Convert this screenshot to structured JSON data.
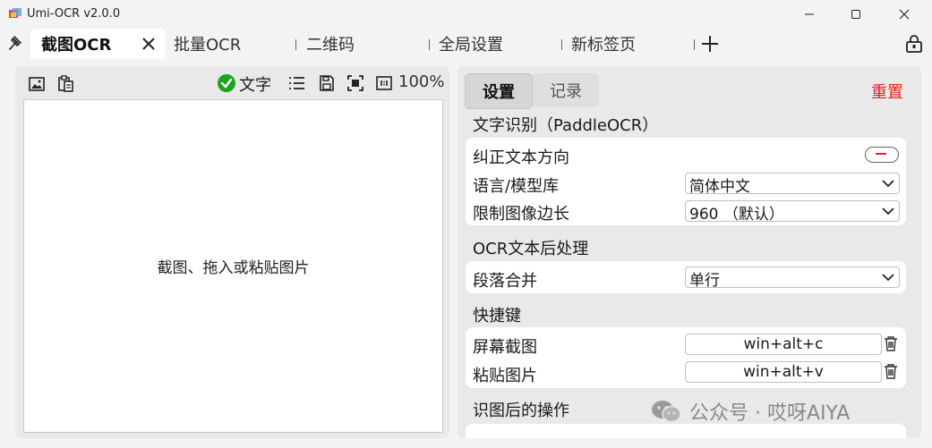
{
  "window": {
    "title": "Umi-OCR v2.0.0"
  },
  "tabs": [
    {
      "label": "截图OCR"
    },
    {
      "label": "批量OCR"
    },
    {
      "label": "二维码"
    },
    {
      "label": "全局设置"
    },
    {
      "label": "新标签页"
    }
  ],
  "left": {
    "text_toggle_label": "文字",
    "zoom": "100%",
    "canvas_hint": "截图、拖入或粘贴图片"
  },
  "right": {
    "segments": {
      "settings": "设置",
      "record": "记录"
    },
    "reset": "重置",
    "groups": {
      "ocr": {
        "title": "文字识别（PaddleOCR）",
        "fix_direction": "纠正文本方向",
        "language_label": "语言/模型库",
        "language_value": "简体中文",
        "limit_label": "限制图像边长",
        "limit_value": "960 （默认）"
      },
      "post": {
        "title": "OCR文本后处理",
        "merge_label": "段落合并",
        "merge_value": "单行"
      },
      "hotkeys": {
        "title": "快捷键",
        "screenshot_label": "屏幕截图",
        "screenshot_value": "win+alt+c",
        "paste_label": "粘贴图片",
        "paste_value": "win+alt+v"
      },
      "after": {
        "title": "识图后的操作"
      }
    }
  },
  "watermark": "公众号 · 哎呀AIYA",
  "colors": {
    "accent_red": "#e8201f",
    "check_green": "#1fa31f"
  }
}
